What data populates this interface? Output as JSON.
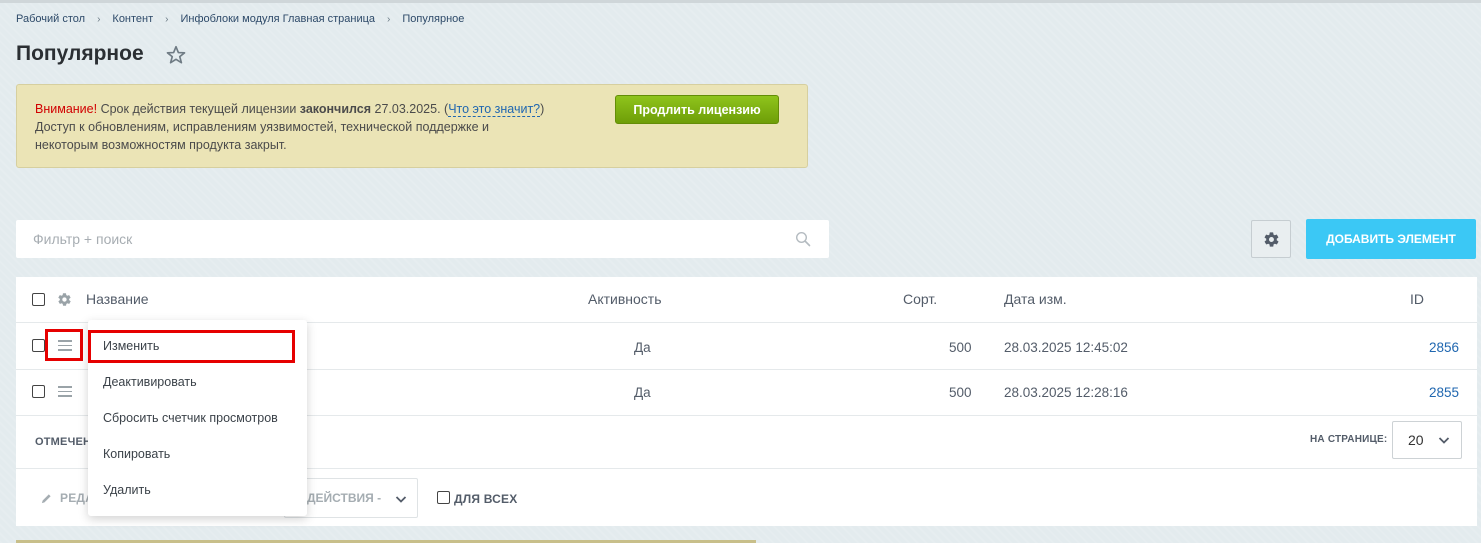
{
  "breadcrumb": [
    "Рабочий стол",
    "Контент",
    "Инфоблоки модуля Главная страница",
    "Популярное"
  ],
  "page_title": "Популярное",
  "alert": {
    "warning": "Внимание!",
    "text1": " Срок действия текущей лицензии ",
    "expired": "закончился",
    "date": " 27.03.2025. (",
    "link": "Что это значит?",
    "close_paren": ")",
    "line2": "Доступ к обновлениям, исправлениям уязвимостей, технической поддержке и",
    "line3": "некоторым возможностям продукта закрыт.",
    "button": "Продлить лицензию"
  },
  "filter": {
    "placeholder": "Фильтр + поиск"
  },
  "toolbar": {
    "add_button": "ДОБАВИТЬ ЭЛЕМЕНТ"
  },
  "grid": {
    "columns": {
      "name": "Название",
      "active": "Активность",
      "sort": "Сорт.",
      "date": "Дата изм.",
      "id": "ID"
    },
    "rows": [
      {
        "active": "Да",
        "sort": "500",
        "date": "28.03.2025 12:45:02",
        "id": "2856"
      },
      {
        "active": "Да",
        "sort": "500",
        "date": "28.03.2025 12:28:16",
        "id": "2855"
      }
    ],
    "selected_label": "ОТМЕЧЕН",
    "per_page_label": "НА СТРАНИЦЕ:",
    "per_page_value": "20",
    "edit_label": "РЕДА",
    "actions_label": "ДЕЙСТВИЯ -",
    "for_all_label": "ДЛЯ ВСЕХ"
  },
  "context_menu": [
    "Изменить",
    "Деактивировать",
    "Сбросить счетчик просмотров",
    "Копировать",
    "Удалить"
  ],
  "colors": {
    "accent": "#3bc8f5",
    "renew": "#7fb10f",
    "highlight": "#e60000",
    "link": "#2067b0"
  }
}
